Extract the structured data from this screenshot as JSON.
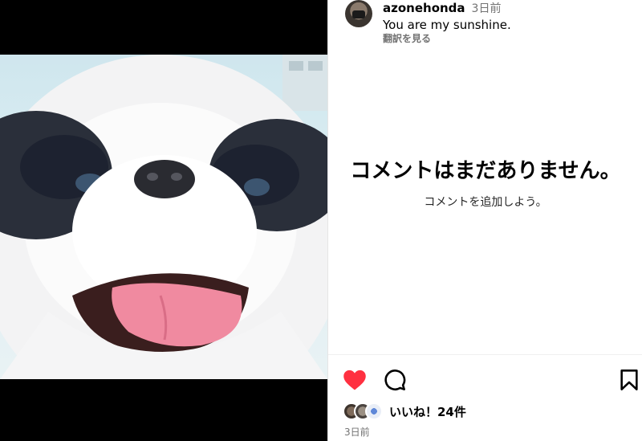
{
  "post": {
    "username": "azonehonda",
    "time_ago": "3日前",
    "caption": "You are my sunshine.",
    "translate_label": "翻訳を見る"
  },
  "comments": {
    "empty_title": "コメントはまだありません。",
    "empty_sub": "コメントを追加しよう。"
  },
  "actions": {
    "liked": true,
    "like_color": "#ff3040",
    "likes_text": "いいね！24件",
    "date": "3日前"
  },
  "icons": {
    "like": "heart-icon",
    "comment": "comment-bubble-icon",
    "save": "bookmark-icon"
  }
}
